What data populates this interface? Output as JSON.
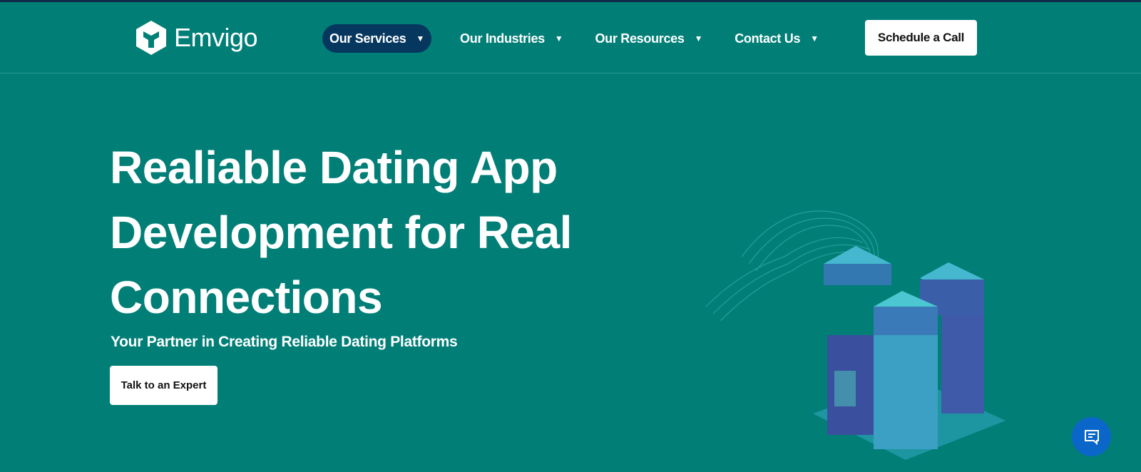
{
  "brand": {
    "name": "Emvigo"
  },
  "nav": {
    "items": [
      {
        "label": "Our Services",
        "active": true
      },
      {
        "label": "Our Industries"
      },
      {
        "label": "Our Resources"
      },
      {
        "label": "Contact Us"
      }
    ],
    "cta": "Schedule a Call"
  },
  "hero": {
    "title": "Realiable Dating App Development for Real Connections",
    "subtitle": "Your Partner in Creating Reliable Dating Platforms",
    "button": "Talk to an Expert"
  },
  "colors": {
    "background": "#017f77",
    "active_nav": "#06375f",
    "chat": "#0a66c8"
  }
}
